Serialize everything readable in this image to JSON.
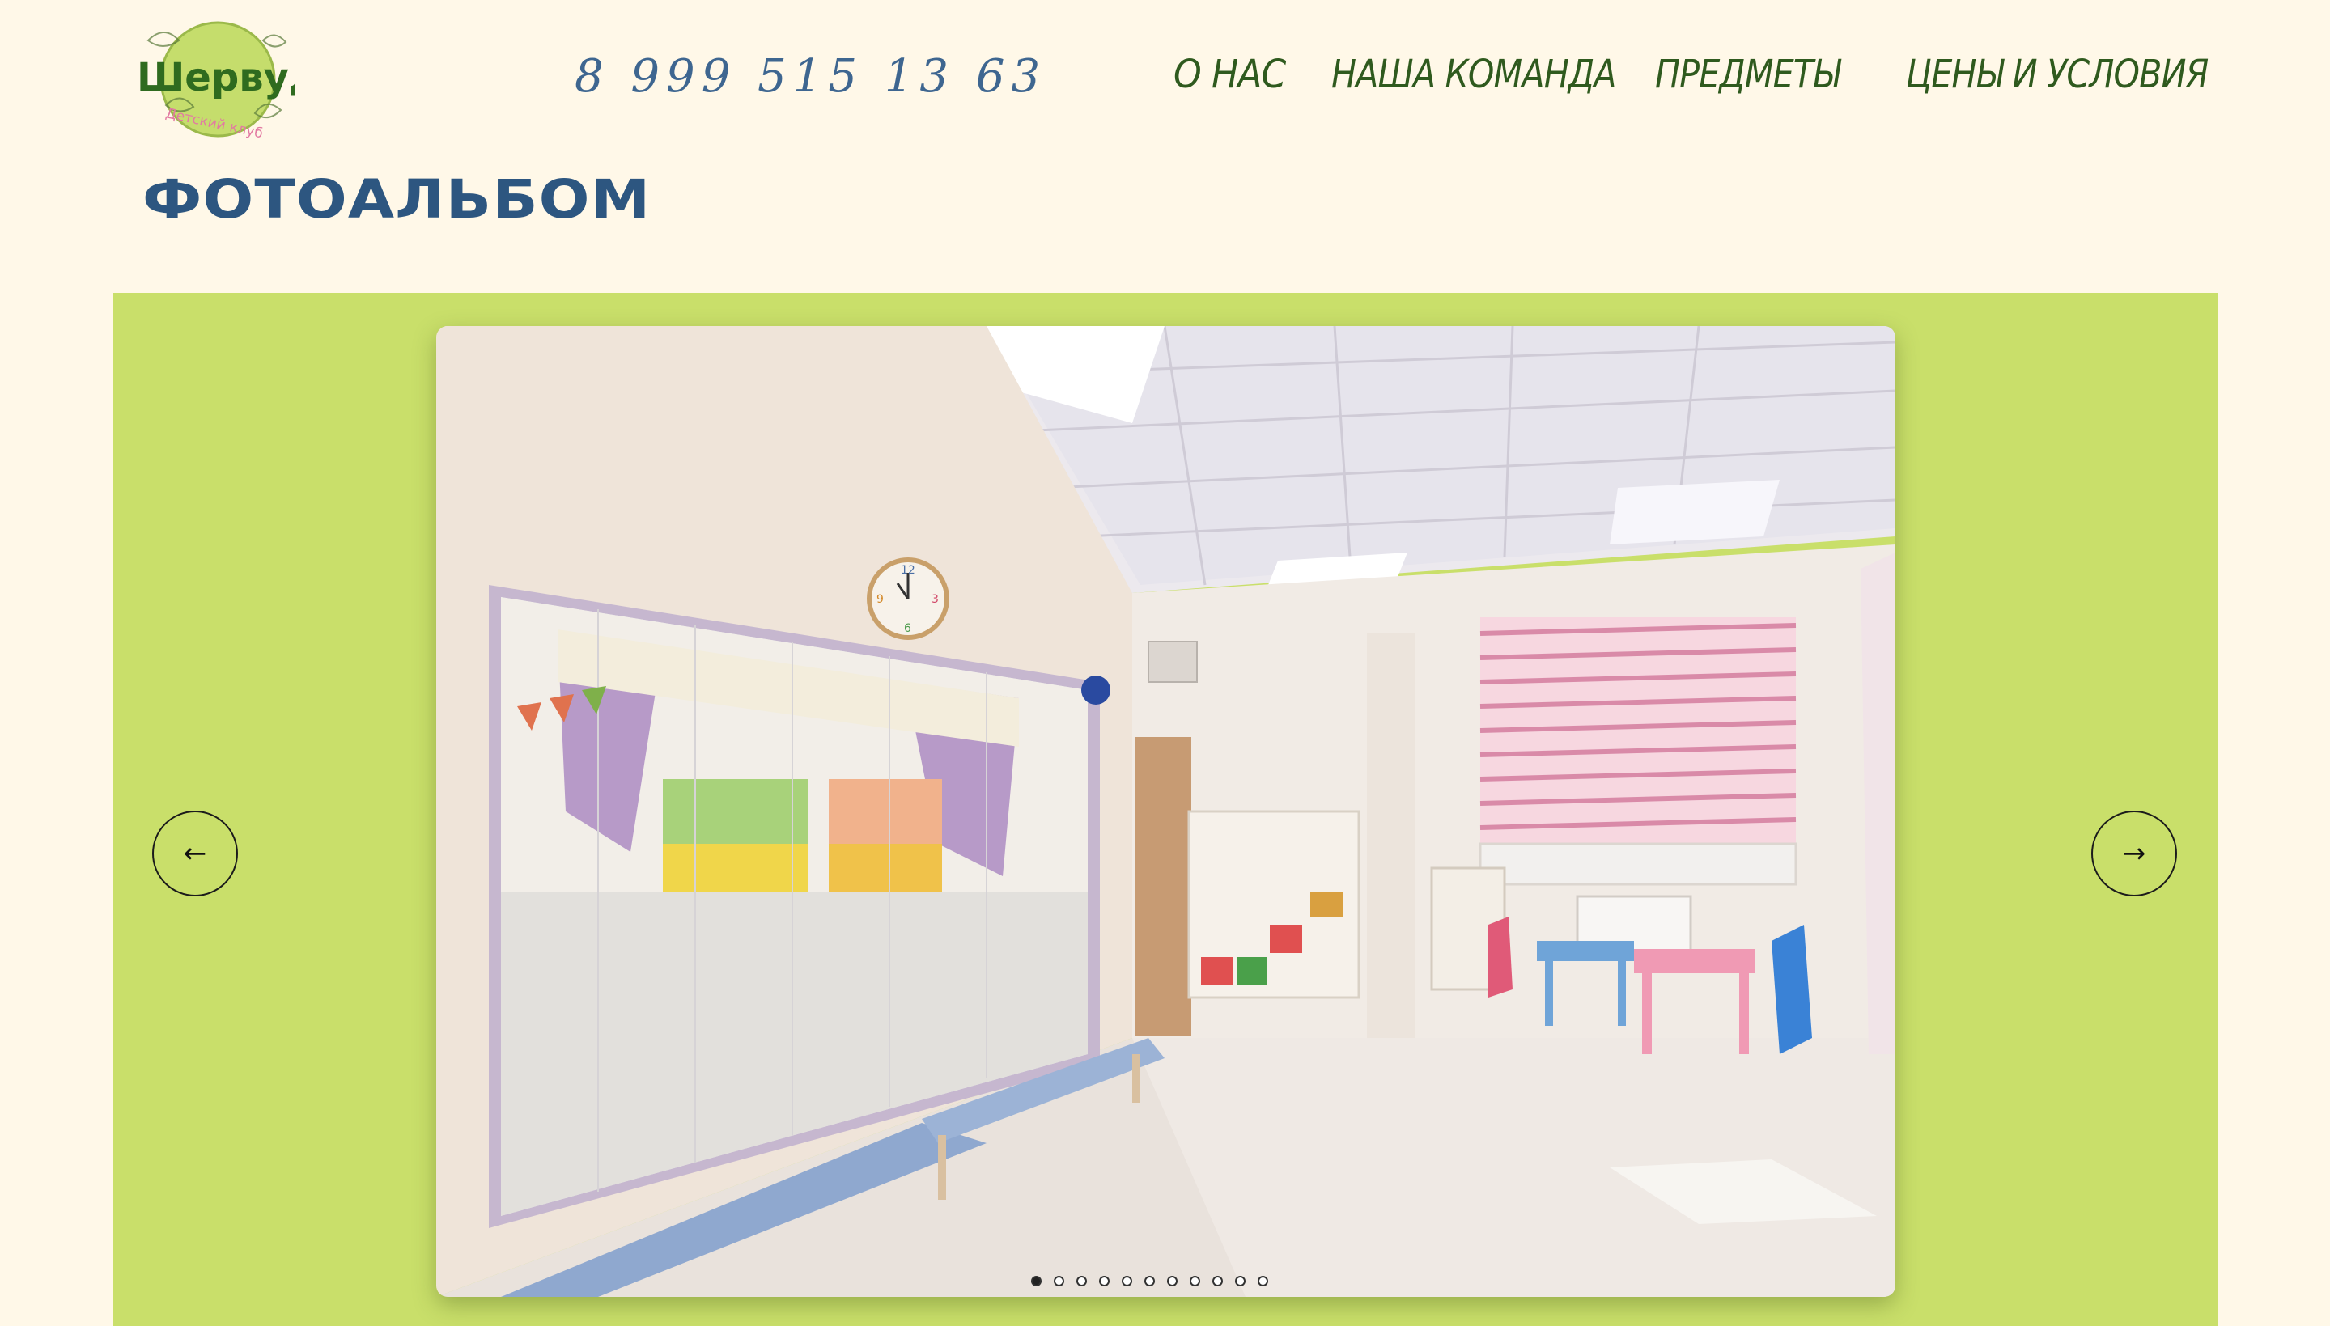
{
  "header": {
    "logo": {
      "name": "Шервуд",
      "subtitle": "Детский клуб"
    },
    "phone": "8 999 515 13 63",
    "nav": [
      {
        "label": "О НАС"
      },
      {
        "label": "НАША КОМАНДА"
      },
      {
        "label": "ПРЕДМЕТЫ"
      },
      {
        "label": "ЦЕНЫ И УСЛОВИЯ"
      }
    ]
  },
  "page": {
    "title": "ФОТОАЛЬБОМ"
  },
  "gallery": {
    "prev_label": "←",
    "next_label": "→",
    "slide_count": 11,
    "active_index": 0,
    "background_color": "#c9df6a",
    "photo_description_icon": "playroom-photo",
    "clock_numbers": [
      "12",
      "3",
      "6",
      "9"
    ]
  },
  "colors": {
    "page_background": "#fff8e8",
    "nav_text": "#2f5a1e",
    "title_text": "#2d5680",
    "phone_text": "#3e6690",
    "logo_green": "#2f6b1f",
    "logo_circle": "#c5dd6c",
    "logo_subtitle": "#e27aa2"
  }
}
